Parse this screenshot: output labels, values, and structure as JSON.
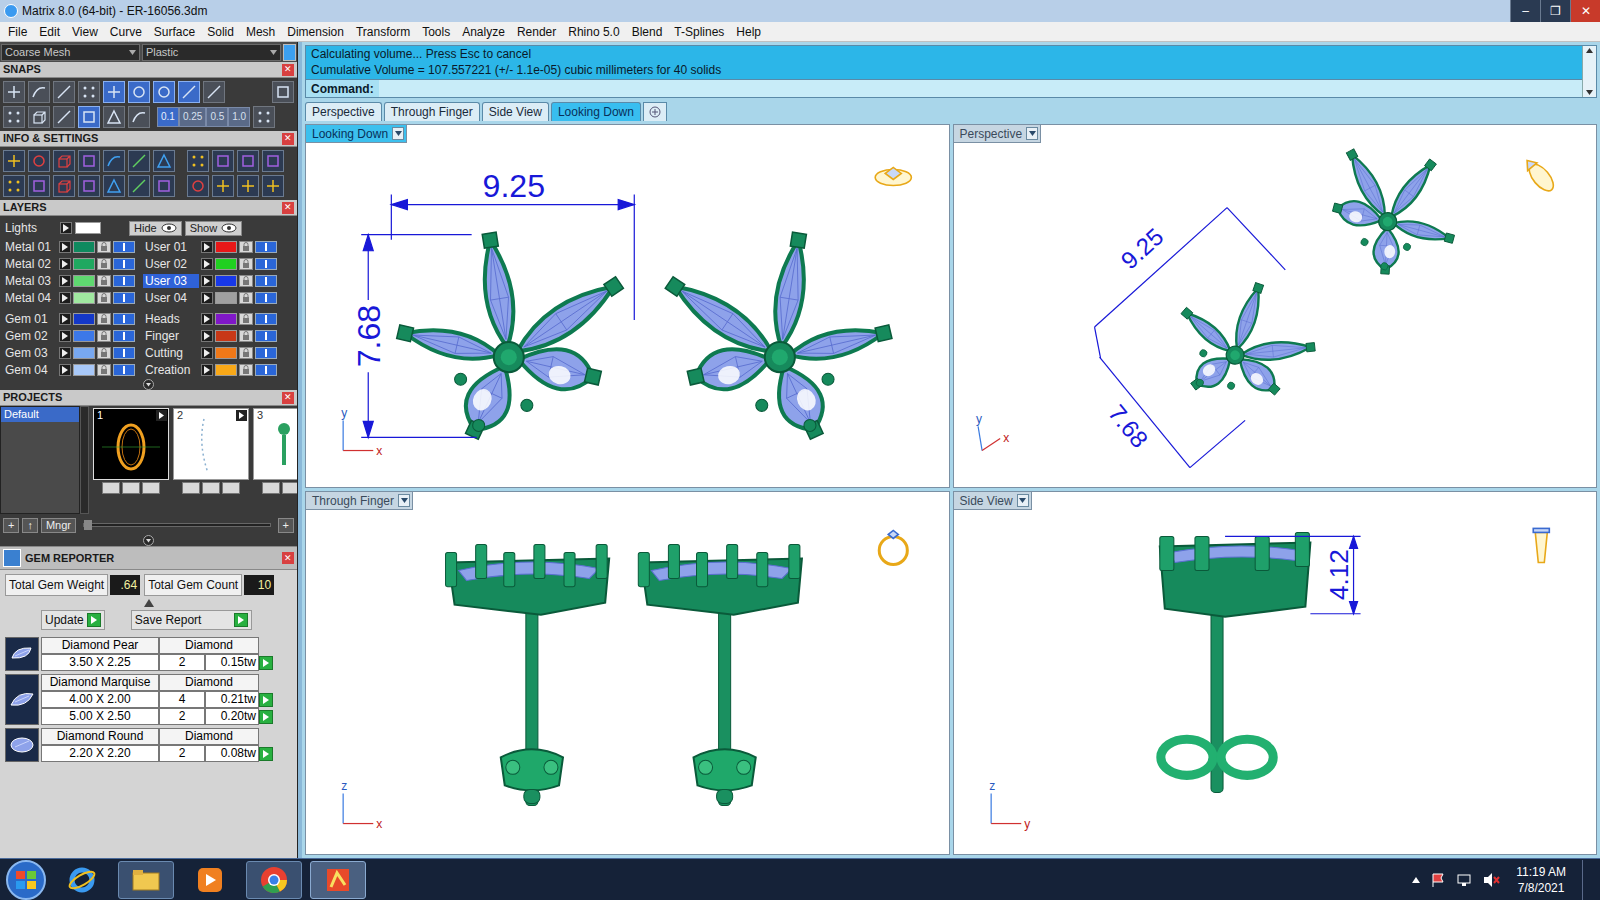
{
  "window": {
    "title": "Matrix 8.0 (64-bit) - ER-16056.3dm",
    "controls": [
      "–",
      "❐",
      "✕"
    ]
  },
  "menu": [
    "File",
    "Edit",
    "View",
    "Curve",
    "Surface",
    "Solid",
    "Mesh",
    "Dimension",
    "Transform",
    "Tools",
    "Analyze",
    "Render",
    "Rhino 5.0",
    "Blend",
    "T-Splines",
    "Help"
  ],
  "display": {
    "mesh": "Coarse Mesh",
    "material": "Plastic"
  },
  "snaps": {
    "title": "SNAPS",
    "close": "✕",
    "values": [
      {
        "label": "0.1",
        "selected": true
      },
      {
        "label": "0.25",
        "selected": false
      },
      {
        "label": "0.5",
        "selected": false
      },
      {
        "label": "1.0",
        "selected": false
      }
    ]
  },
  "info": {
    "title": "INFO & SETTINGS",
    "close": "✕"
  },
  "layers": {
    "title": "LAYERS",
    "close": "✕",
    "lights": {
      "label": "Lights",
      "color": "#ffffff"
    },
    "hide": "Hide",
    "show": "Show",
    "left": [
      {
        "name": "Metal 01",
        "color": "#0f8a5f",
        "selected": false
      },
      {
        "name": "Metal 02",
        "color": "#1fa860",
        "selected": false
      },
      {
        "name": "Metal 03",
        "color": "#5fd870",
        "selected": false
      },
      {
        "name": "Metal 04",
        "color": "#a0e8a0",
        "selected": false
      },
      {
        "name": "Gem 01",
        "color": "#1438c8",
        "selected": false
      },
      {
        "name": "Gem 02",
        "color": "#3c78e8",
        "selected": false
      },
      {
        "name": "Gem 03",
        "color": "#78a8f0",
        "selected": false
      },
      {
        "name": "Gem 04",
        "color": "#a8c8f8",
        "selected": false
      }
    ],
    "right": [
      {
        "name": "User 01",
        "color": "#e81818",
        "selected": false
      },
      {
        "name": "User 02",
        "color": "#20d020",
        "selected": false
      },
      {
        "name": "User 03",
        "color": "#1838e8",
        "selected": true
      },
      {
        "name": "User 04",
        "color": "#a0a0a0",
        "selected": false
      },
      {
        "name": "Heads",
        "color": "#8018c8",
        "selected": false
      },
      {
        "name": "Finger",
        "color": "#c83818",
        "selected": false
      },
      {
        "name": "Cutting",
        "color": "#f07818",
        "selected": false
      },
      {
        "name": "Creation",
        "color": "#f8a818",
        "selected": false
      }
    ]
  },
  "projects": {
    "title": "PROJECTS",
    "close": "✕",
    "list": [
      {
        "label": "Default",
        "selected": true
      }
    ],
    "thumbnails": [
      {
        "label": "1",
        "kind": "ring",
        "selected": true
      },
      {
        "label": "2",
        "kind": "curve",
        "selected": false
      },
      {
        "label": "3",
        "kind": "partial",
        "selected": false
      }
    ],
    "buttons": [
      "+",
      "↑",
      "Mngr"
    ],
    "add": "+"
  },
  "gem_reporter": {
    "title": "GEM REPORTER",
    "close": "✕",
    "weight_label": "Total Gem Weight",
    "weight": ".64",
    "count_label": "Total Gem Count",
    "count": "10",
    "update": "Update",
    "save": "Save Report",
    "groups": [
      {
        "name": "Diamond Pear",
        "type": "Diamond",
        "shape": "pear",
        "rows": [
          {
            "size": "3.50 X 2.25",
            "count": "2",
            "weight": "0.15tw"
          }
        ]
      },
      {
        "name": "Diamond Marquise",
        "type": "Diamond",
        "shape": "marquise",
        "rows": [
          {
            "size": "4.00 X 2.00",
            "count": "4",
            "weight": "0.21tw"
          },
          {
            "size": "5.00 X 2.50",
            "count": "2",
            "weight": "0.20tw"
          }
        ]
      },
      {
        "name": "Diamond Round",
        "type": "Diamond",
        "shape": "round",
        "rows": [
          {
            "size": "2.20 X 2.20",
            "count": "2",
            "weight": "0.08tw"
          }
        ]
      }
    ]
  },
  "command": {
    "lines": [
      "Calculating volume... Press Esc to cancel",
      "Cumulative Volume = 107.557221 (+/- 1.1e-05) cubic millimeters for 40 solids"
    ],
    "prompt": "Command:"
  },
  "tabs": [
    {
      "label": "Perspective",
      "selected": false
    },
    {
      "label": "Through Finger",
      "selected": false
    },
    {
      "label": "Side View",
      "selected": false
    },
    {
      "label": "Looking Down",
      "selected": true
    }
  ],
  "viewports": [
    {
      "title": "Looking Down",
      "kind": "top",
      "active": true,
      "dimensions": [
        "9.25",
        "7.68"
      ],
      "axes": [
        "y",
        "x"
      ]
    },
    {
      "title": "Perspective",
      "kind": "perspective",
      "active": false,
      "dimensions": [
        "9.25",
        "7.68"
      ],
      "axes": [
        "y",
        "x"
      ]
    },
    {
      "title": "Through Finger",
      "kind": "front",
      "active": false,
      "dimensions": [],
      "axes": [
        "z",
        "x"
      ]
    },
    {
      "title": "Side View",
      "kind": "side",
      "active": false,
      "dimensions": [
        "4.12"
      ],
      "axes": [
        "z",
        "y"
      ]
    }
  ],
  "taskbar": {
    "time": "11:19 AM",
    "date": "7/8/2021"
  }
}
